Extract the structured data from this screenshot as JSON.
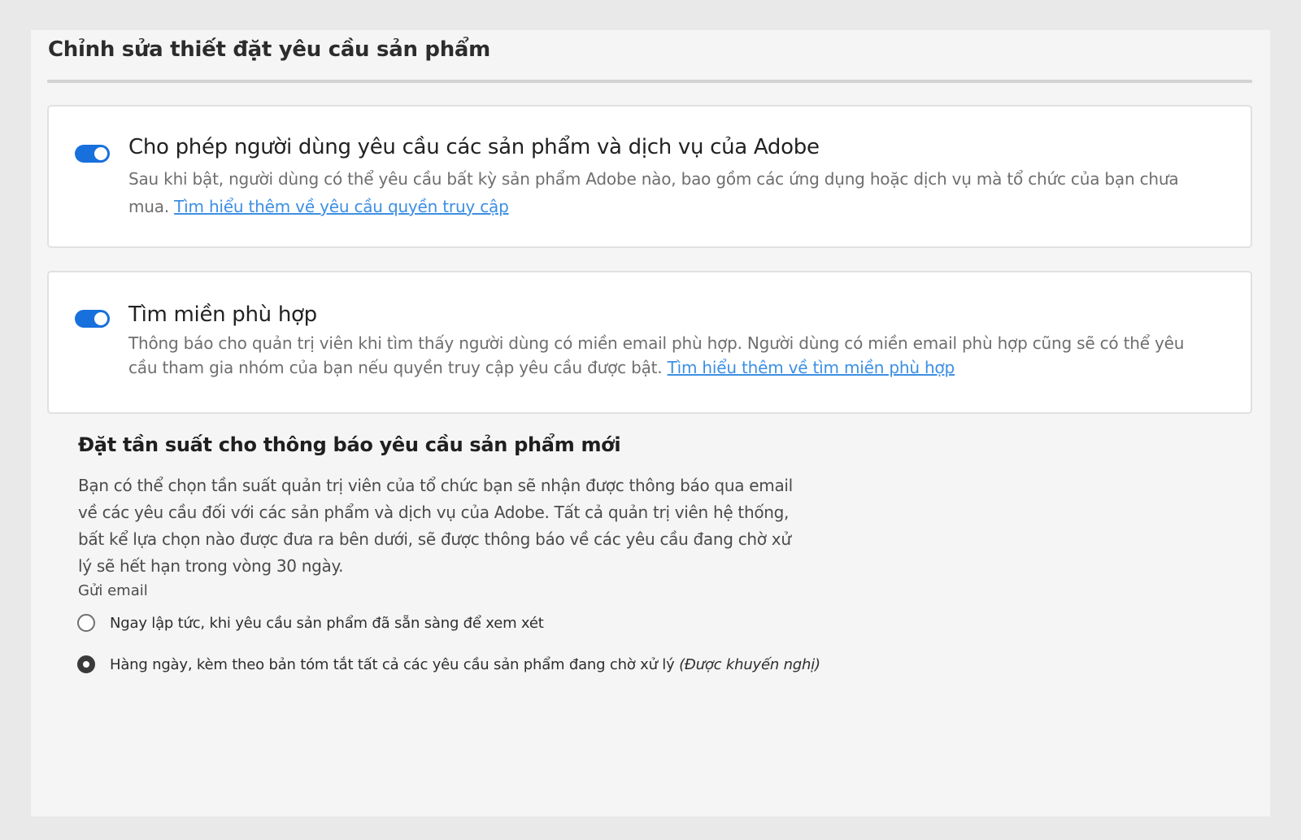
{
  "page": {
    "title": "Chỉnh sửa thiết đặt yêu cầu sản phẩm"
  },
  "request_access": {
    "enabled": true,
    "heading": "Cho phép người dùng yêu cầu các sản phẩm và dịch vụ của Adobe",
    "description": "Sau khi bật, người dùng có thể yêu cầu bất kỳ sản phẩm Adobe nào, bao gồm các ứng dụng hoặc dịch vụ mà tổ chức của bạn chưa mua. ",
    "link_text": "Tìm hiểu thêm về yêu cầu quyền truy cập"
  },
  "domain_match": {
    "enabled": true,
    "heading": "Tìm miền phù hợp",
    "description": "Thông báo cho quản trị viên khi tìm thấy người dùng có miền email phù hợp. Người dùng có miền email phù hợp cũng sẽ có thể yêu cầu tham gia nhóm của bạn nếu quyền truy cập yêu cầu được bật. ",
    "link_text": "Tìm hiểu thêm về tìm miền phù hợp"
  },
  "notifications": {
    "title": "Đặt tần suất cho thông báo yêu cầu sản phẩm mới",
    "description": "Bạn có thể chọn tần suất quản trị viên của tổ chức bạn sẽ nhận được thông báo qua email về các yêu cầu đối với các sản phẩm và dịch vụ của Adobe. Tất cả quản trị viên hệ thống, bất kể lựa chọn nào được đưa ra bên dưới, sẽ được thông báo về các yêu cầu đang chờ xử lý sẽ hết hạn trong vòng 30 ngày.",
    "send_label": "Gửi email",
    "options": [
      {
        "label": "Ngay lập tức, khi yêu cầu sản phẩm đã sẵn sàng để xem xét",
        "note": "",
        "selected": false
      },
      {
        "label": "Hàng ngày, kèm theo bản tóm tắt tất cả các yêu cầu sản phẩm đang chờ xử lý ",
        "note": "(Được khuyến nghị)",
        "selected": true
      }
    ]
  },
  "colors": {
    "accent": "#1870dc",
    "link": "#3d8fe3"
  }
}
